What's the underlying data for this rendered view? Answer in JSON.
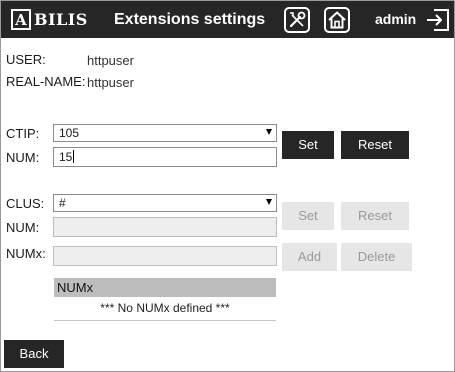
{
  "header": {
    "logo_letter": "A",
    "logo_text": "BILIS",
    "title": "Extensions settings",
    "user": "admin",
    "icons": [
      "tools-icon",
      "home-icon",
      "logout-icon"
    ]
  },
  "info": {
    "user_label": "USER:",
    "user_value": "httpuser",
    "realname_label": "REAL-NAME:",
    "realname_value": "httpuser"
  },
  "ctip": {
    "label": "CTIP:",
    "selected": "105",
    "num_label": "NUM:",
    "num_value": "15",
    "set_label": "Set",
    "reset_label": "Reset"
  },
  "clus": {
    "label": "CLUS:",
    "selected": "#",
    "num_label": "NUM:",
    "num_value": "",
    "set_label": "Set",
    "reset_label": "Reset",
    "numx_label": "NUMx:",
    "numx_value": "",
    "add_label": "Add",
    "delete_label": "Delete"
  },
  "numx_table": {
    "header": "NUMx",
    "empty_message": "*** No NUMx defined ***"
  },
  "footer": {
    "back_label": "Back"
  },
  "colors": {
    "header_bg": "#262626",
    "button_bg": "#262626",
    "button_disabled_bg": "#e6e6e6",
    "table_header_bg": "#bdbdbd"
  }
}
